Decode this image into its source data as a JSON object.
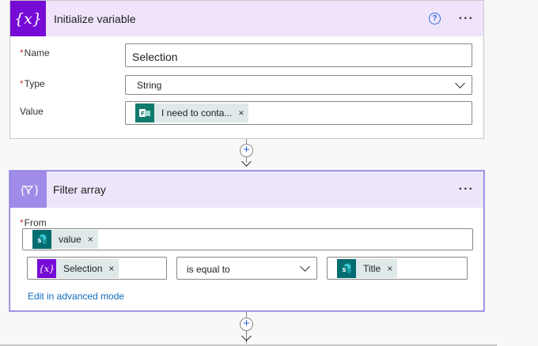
{
  "initialize_variable": {
    "title": "Initialize variable",
    "icon": "{x}",
    "help_icon": "?",
    "more_icon": "...",
    "name_label": "Name",
    "name_value": "Selection",
    "type_label": "Type",
    "type_value": "String",
    "value_label": "Value",
    "value_token": {
      "label": "I need to conta...",
      "icon": "outlook-forms-icon",
      "close": "×"
    },
    "required_mark": "*"
  },
  "filter_array": {
    "title": "Filter array",
    "icon": "{▽}",
    "more_icon": "...",
    "from_label": "From",
    "required_mark": "*",
    "from_token": {
      "label": "value",
      "icon": "sharepoint-icon",
      "close": "×"
    },
    "left_token": {
      "label": "Selection",
      "icon": "variable-icon",
      "icon_text": "{x}",
      "close": "×"
    },
    "operator": "is equal to",
    "right_token": {
      "label": "Title",
      "icon": "sharepoint-icon",
      "close": "×"
    },
    "advanced_link": "Edit in advanced mode"
  },
  "connector": {
    "plus": "+"
  },
  "colors": {
    "variable_purple": "#770bd6",
    "filter_purple": "#a08be8",
    "sharepoint_teal": "#036c70",
    "link_blue": "#0f6cbd"
  }
}
